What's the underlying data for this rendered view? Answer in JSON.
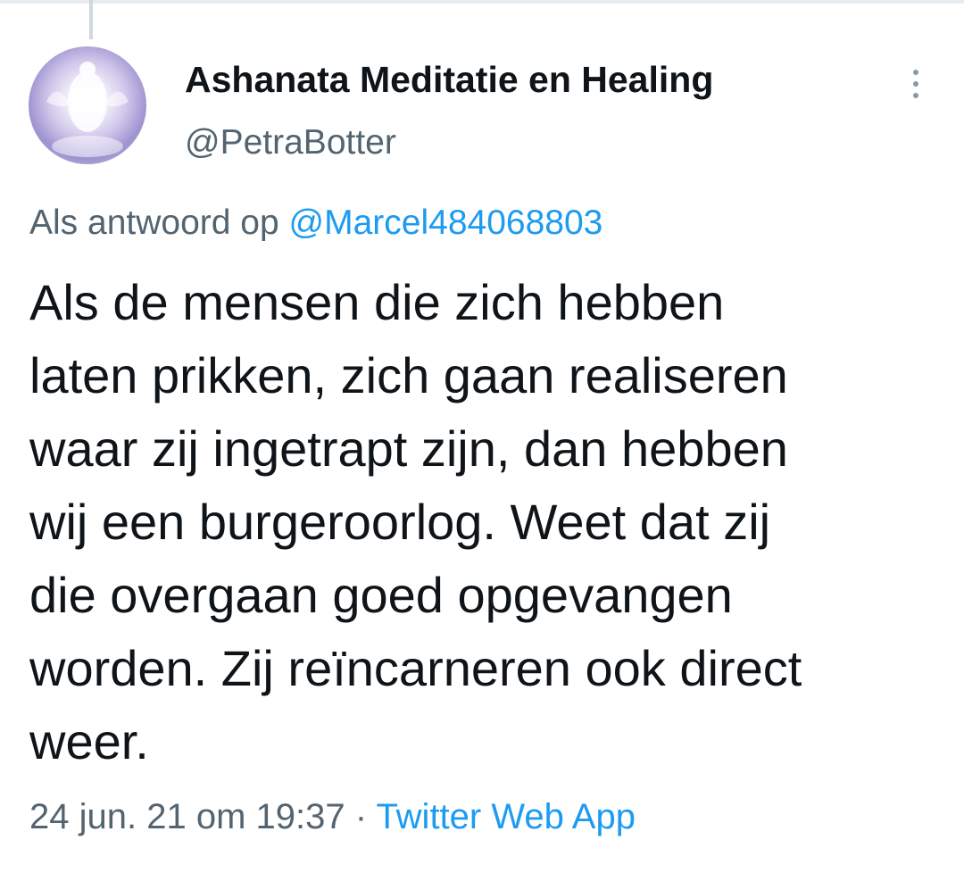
{
  "tweet": {
    "author": {
      "name": "Ashanata Meditatie en Healing",
      "handle": "@PetraBotter",
      "avatar_icon": "avatar-image"
    },
    "more_icon": "more-vertical-icon",
    "reply_to": {
      "prefix": "Als antwoord op",
      "mention": "@Marcel484068803"
    },
    "text": "Als de mensen die zich hebben\nlaten prikken, zich gaan realiseren\nwaar zij ingetrapt zijn, dan hebben\nwij een burgeroorlog. Weet dat zij\ndie overgaan goed opgevangen\nworden. Zij reïncarneren ook direct\nweer.",
    "timestamp": "24 jun. 21 om 19:37",
    "separator": "·",
    "source": "Twitter Web App"
  },
  "colors": {
    "text_primary": "#0f1419",
    "text_secondary": "#536471",
    "link": "#1d9bf0",
    "thread_line": "#cfd9de"
  }
}
